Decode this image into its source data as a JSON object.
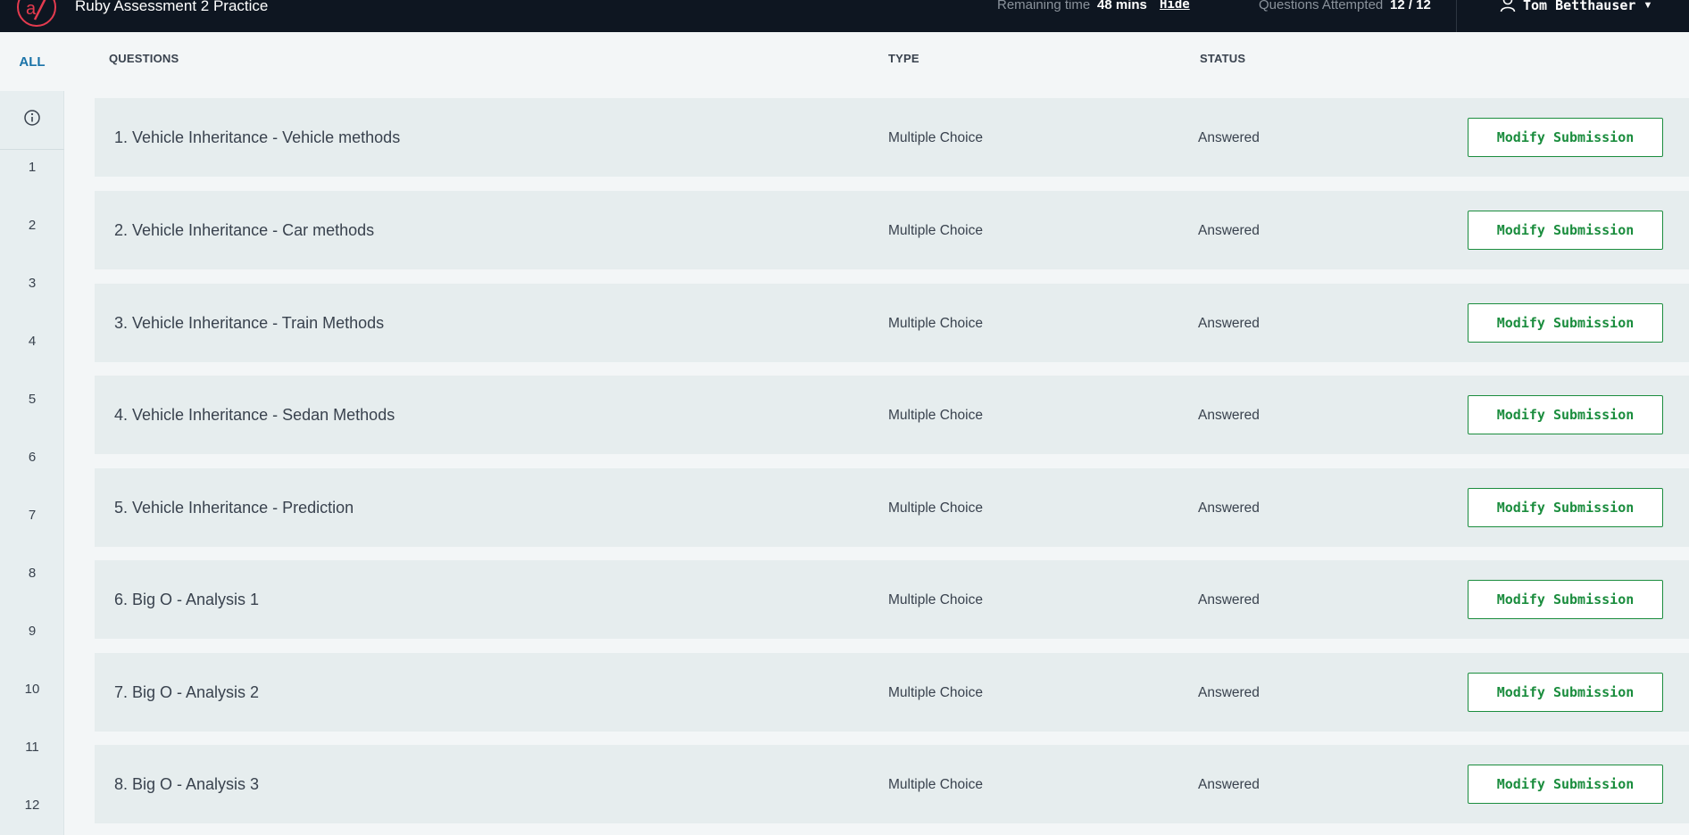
{
  "header": {
    "app_title": "Ruby Assessment 2 Practice",
    "remaining_label": "Remaining time",
    "remaining_value": "48 mins",
    "hide_label": "Hide",
    "attempted_label": "Questions Attempted",
    "attempted_value": "12 / 12",
    "user_name": "Tom Betthauser",
    "logo_color": "#e43b4f"
  },
  "sidebar": {
    "all_label": "ALL",
    "info_icon": "info-icon",
    "numbers": [
      "1",
      "2",
      "3",
      "4",
      "5",
      "6",
      "7",
      "8",
      "9",
      "10",
      "11",
      "12"
    ]
  },
  "columns": {
    "questions": "QUESTIONS",
    "type": "TYPE",
    "status": "STATUS"
  },
  "rows": [
    {
      "title": "1. Vehicle Inheritance - Vehicle methods",
      "type": "Multiple Choice",
      "status": "Answered",
      "action": "Modify Submission"
    },
    {
      "title": "2. Vehicle Inheritance - Car methods",
      "type": "Multiple Choice",
      "status": "Answered",
      "action": "Modify Submission"
    },
    {
      "title": "3. Vehicle Inheritance - Train Methods",
      "type": "Multiple Choice",
      "status": "Answered",
      "action": "Modify Submission"
    },
    {
      "title": "4. Vehicle Inheritance - Sedan Methods",
      "type": "Multiple Choice",
      "status": "Answered",
      "action": "Modify Submission"
    },
    {
      "title": "5. Vehicle Inheritance - Prediction",
      "type": "Multiple Choice",
      "status": "Answered",
      "action": "Modify Submission"
    },
    {
      "title": "6. Big O - Analysis 1",
      "type": "Multiple Choice",
      "status": "Answered",
      "action": "Modify Submission"
    },
    {
      "title": "7. Big O - Analysis 2",
      "type": "Multiple Choice",
      "status": "Answered",
      "action": "Modify Submission"
    },
    {
      "title": "8. Big O - Analysis 3",
      "type": "Multiple Choice",
      "status": "Answered",
      "action": "Modify Submission"
    }
  ],
  "colors": {
    "topbar": "#0e1621",
    "accent_green": "#1b8d3e",
    "link_blue": "#1a73a8",
    "row_bg": "#e6edee"
  }
}
